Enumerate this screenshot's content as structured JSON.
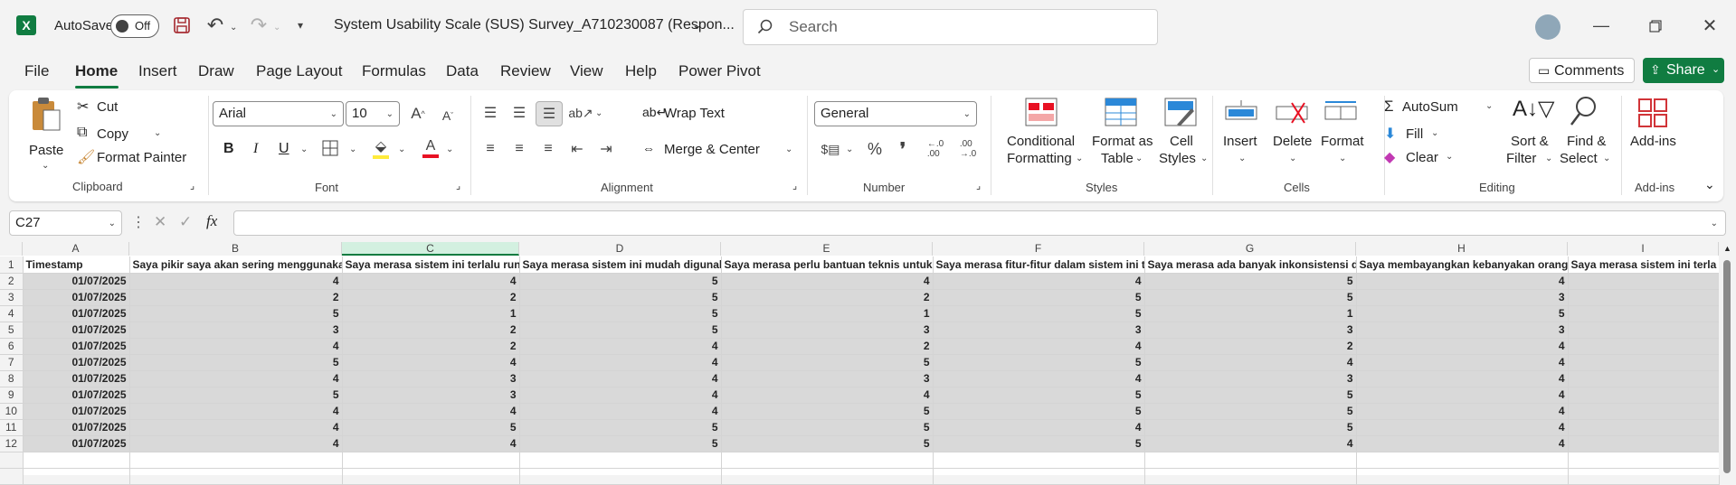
{
  "titlebar": {
    "autosave_label": "AutoSave",
    "autosave_state": "Off",
    "doc_title": "System Usability Scale (SUS) Survey_A710230087 (Respon...",
    "search_placeholder": "Search"
  },
  "menu": [
    "File",
    "Home",
    "Insert",
    "Draw",
    "Page Layout",
    "Formulas",
    "Data",
    "Review",
    "View",
    "Help",
    "Power Pivot"
  ],
  "menu_active": "Home",
  "top_buttons": {
    "comments": "Comments",
    "share": "Share"
  },
  "ribbon": {
    "clipboard": {
      "paste": "Paste",
      "cut": "Cut",
      "copy": "Copy",
      "format_painter": "Format Painter",
      "label": "Clipboard"
    },
    "font": {
      "name": "Arial",
      "size": "10",
      "label": "Font",
      "bold": "B",
      "italic": "I",
      "underline": "U"
    },
    "alignment": {
      "wrap": "Wrap Text",
      "merge": "Merge & Center",
      "label": "Alignment"
    },
    "number": {
      "format": "General",
      "label": "Number"
    },
    "styles": {
      "cond1": "Conditional",
      "cond2": "Formatting",
      "fat1": "Format as",
      "fat2": "Table",
      "cs1": "Cell",
      "cs2": "Styles",
      "label": "Styles"
    },
    "cells": {
      "insert": "Insert",
      "delete": "Delete",
      "format": "Format",
      "label": "Cells"
    },
    "editing": {
      "autosum": "AutoSum",
      "fill": "Fill",
      "clear": "Clear",
      "sort1": "Sort &",
      "sort2": "Filter",
      "find1": "Find &",
      "find2": "Select",
      "label": "Editing"
    },
    "addins": {
      "addins": "Add-ins",
      "label": "Add-ins"
    }
  },
  "formula_bar": {
    "name_box": "C27",
    "fx": "fx",
    "value": ""
  },
  "columns": [
    "A",
    "B",
    "C",
    "D",
    "E",
    "F",
    "G",
    "H",
    "I"
  ],
  "headers": [
    "Timestamp",
    "Saya pikir saya akan sering menggunaka",
    "Saya merasa sistem ini terlalu run",
    "Saya merasa sistem ini mudah digunak",
    "Saya merasa perlu bantuan teknis untuk",
    "Saya merasa fitur-fitur dalam sistem ini t",
    "Saya merasa ada banyak inkonsistensi d",
    "Saya membayangkan kebanyakan orang",
    "Saya merasa sistem ini terla"
  ],
  "rows": [
    [
      "01/07/2025",
      "4",
      "4",
      "5",
      "4",
      "4",
      "5",
      "4",
      ""
    ],
    [
      "01/07/2025",
      "2",
      "2",
      "5",
      "2",
      "5",
      "5",
      "3",
      ""
    ],
    [
      "01/07/2025",
      "5",
      "1",
      "5",
      "1",
      "5",
      "1",
      "5",
      ""
    ],
    [
      "01/07/2025",
      "3",
      "2",
      "5",
      "3",
      "3",
      "3",
      "3",
      ""
    ],
    [
      "01/07/2025",
      "4",
      "2",
      "4",
      "2",
      "4",
      "2",
      "4",
      ""
    ],
    [
      "01/07/2025",
      "5",
      "4",
      "4",
      "5",
      "5",
      "4",
      "4",
      ""
    ],
    [
      "01/07/2025",
      "4",
      "3",
      "4",
      "3",
      "4",
      "3",
      "4",
      ""
    ],
    [
      "01/07/2025",
      "5",
      "3",
      "4",
      "4",
      "5",
      "5",
      "4",
      ""
    ],
    [
      "01/07/2025",
      "4",
      "4",
      "4",
      "5",
      "5",
      "5",
      "4",
      ""
    ],
    [
      "01/07/2025",
      "4",
      "5",
      "5",
      "5",
      "4",
      "5",
      "4",
      ""
    ],
    [
      "01/07/2025",
      "4",
      "4",
      "5",
      "5",
      "5",
      "4",
      "4",
      ""
    ]
  ],
  "colors": {
    "accent": "#107c41",
    "excel": "#217346",
    "selected_col": "#d3f0e0"
  }
}
